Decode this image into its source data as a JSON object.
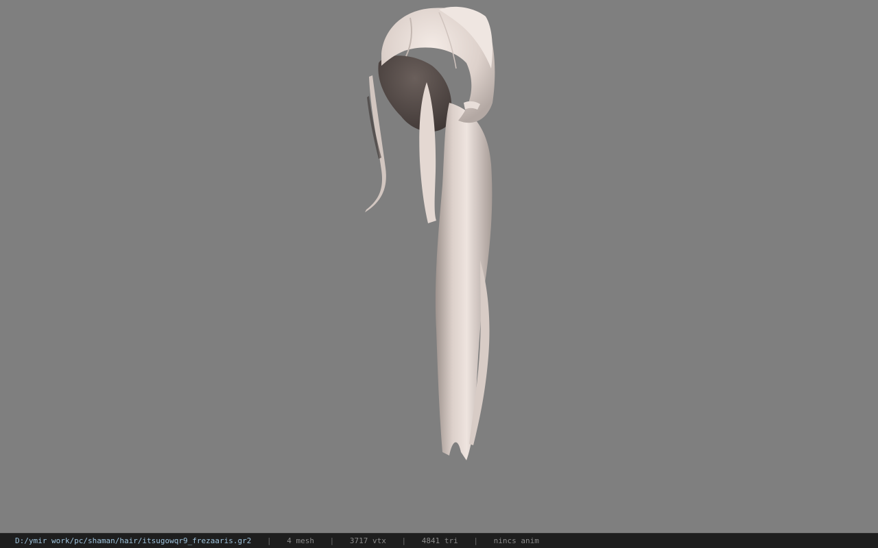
{
  "viewport": {
    "background_color": "#7f7f7f",
    "model_subject": "hair-ponytail-mesh"
  },
  "status_bar": {
    "file_path": "D:/ymir work/pc/shaman/hair/itsugowqr9_frezaaris.gr2",
    "separator": "|",
    "mesh_count": "4 mesh",
    "vertex_count": "3717 vtx",
    "triangle_count": "4841 tri",
    "animation": "nincs anim",
    "path_color": "#9fc3dc",
    "background_color": "#1e1e1e"
  }
}
